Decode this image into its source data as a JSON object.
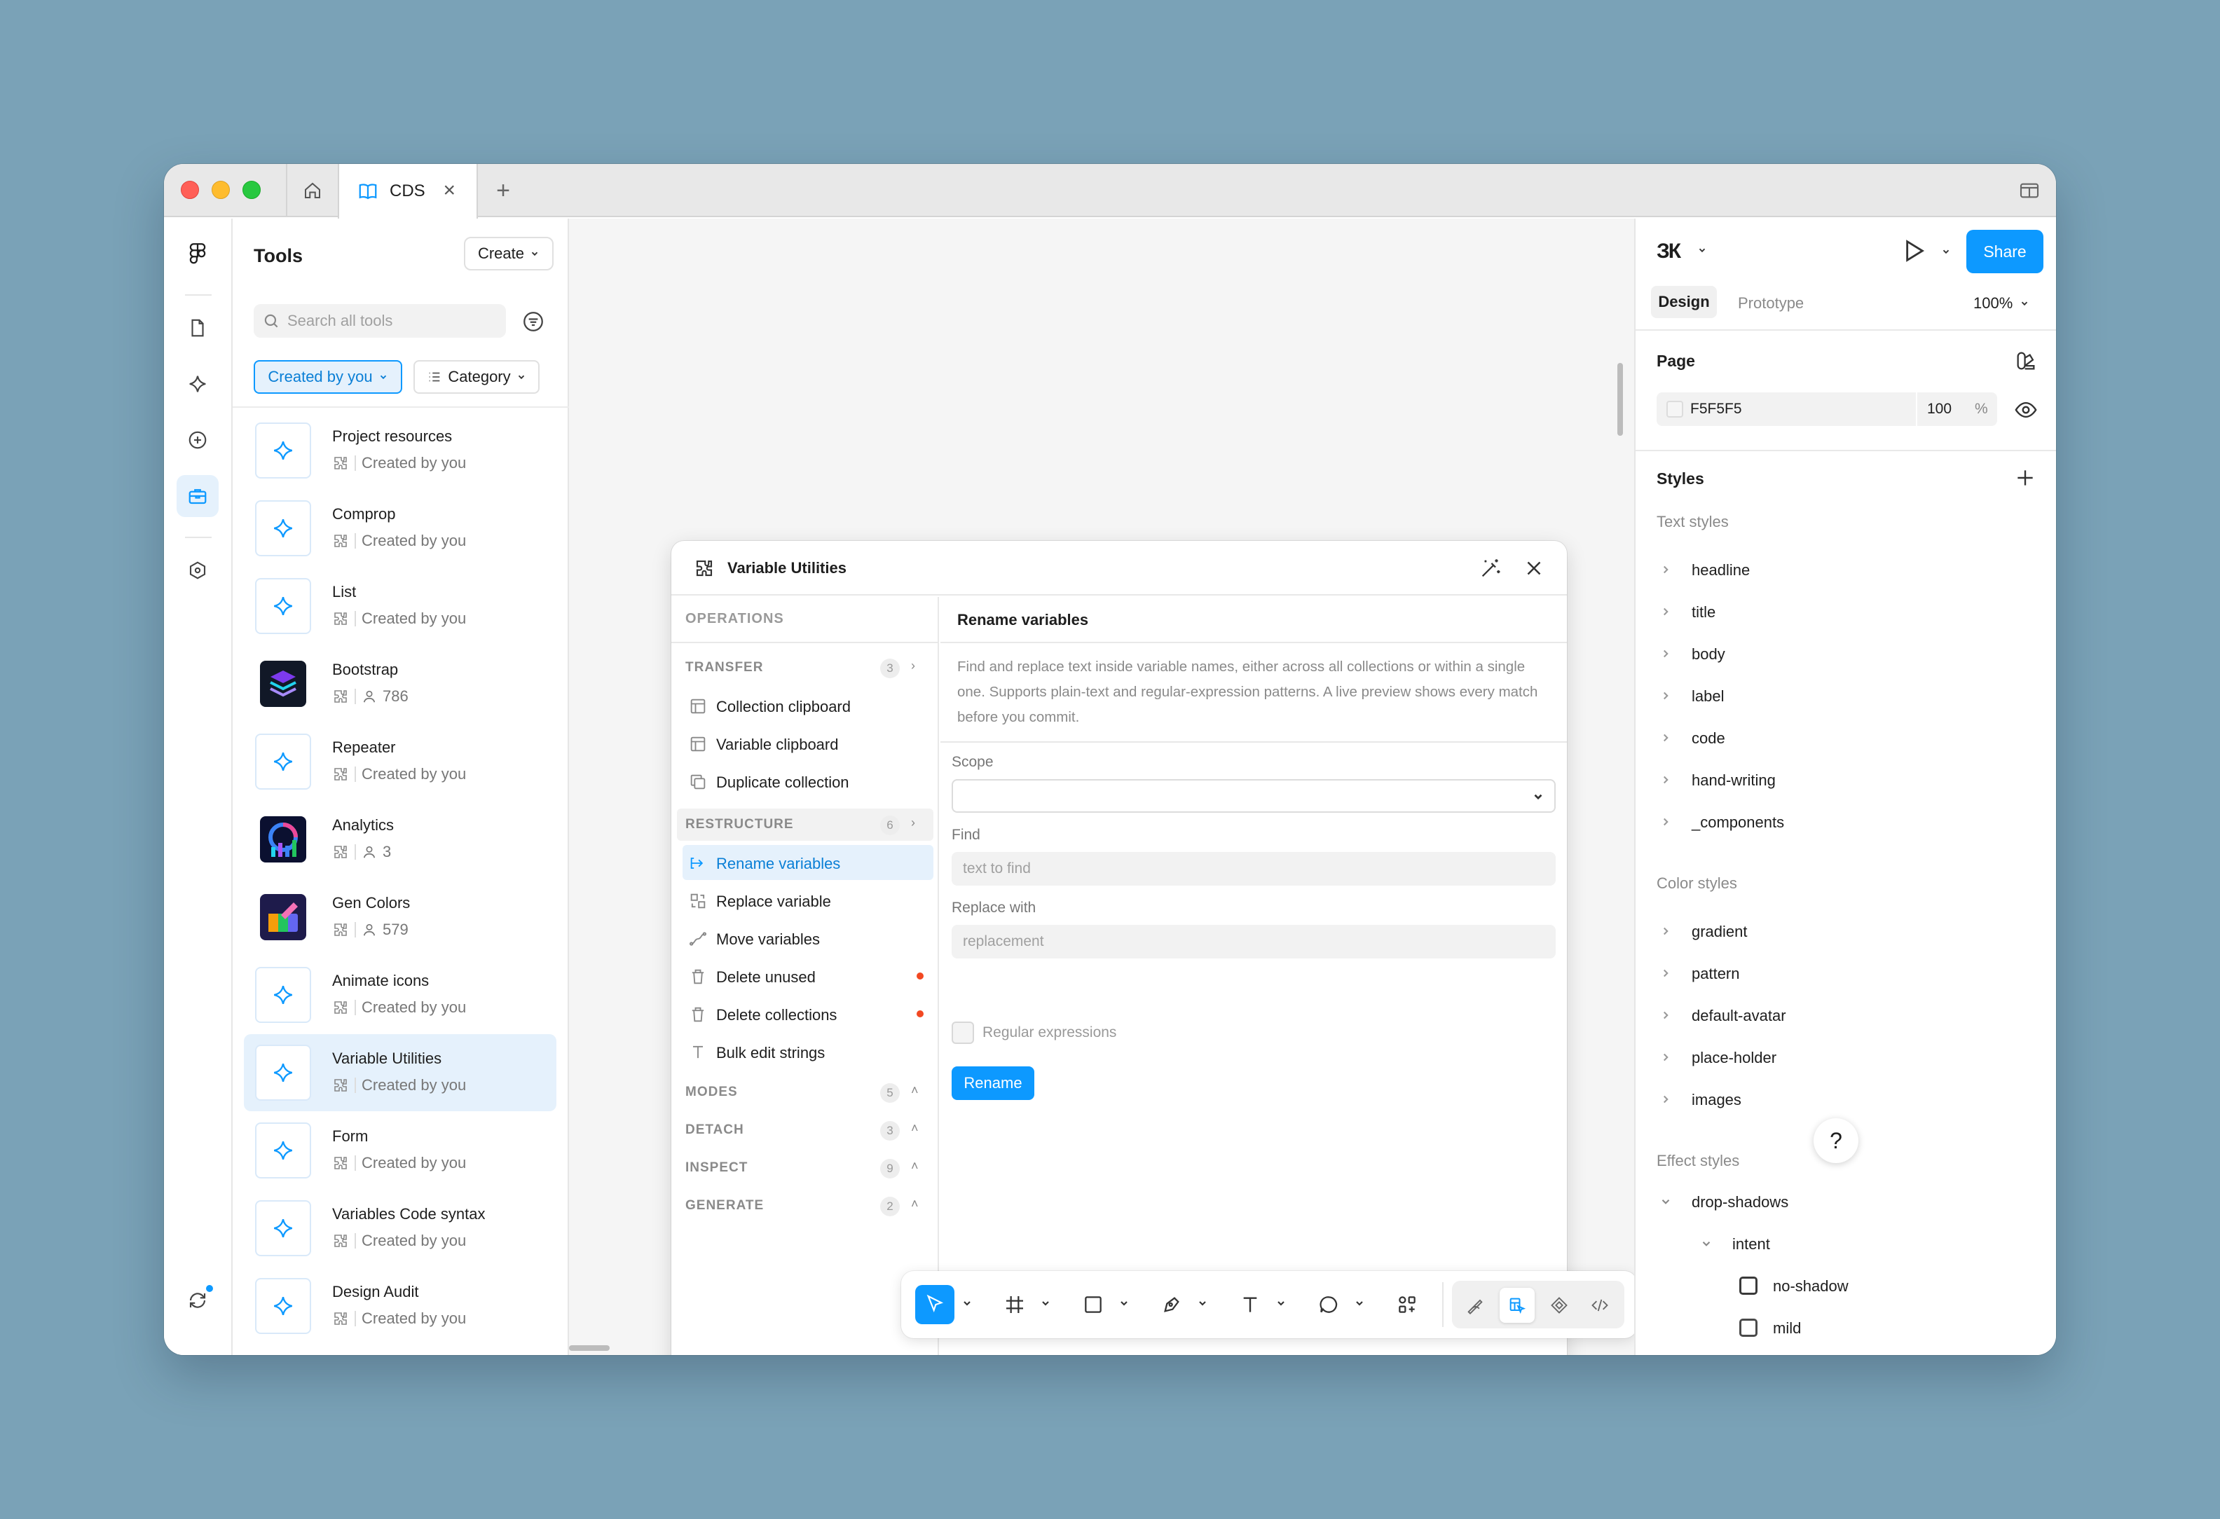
{
  "window": {
    "tab_title": "CDS"
  },
  "tools_panel": {
    "title": "Tools",
    "create_label": "Create",
    "search_placeholder": "Search all tools",
    "filter_created_by_you": "Created by you",
    "filter_category": "Category",
    "items": [
      {
        "name": "Project resources",
        "meta": "Created by you",
        "thumb": "sparkle-icon"
      },
      {
        "name": "Comprop",
        "meta": "Created by you",
        "thumb": "sparkle-icon"
      },
      {
        "name": "List",
        "meta": "Created by you",
        "thumb": "sparkle-icon"
      },
      {
        "name": "Bootstrap",
        "meta": "786",
        "thumb": "bootstrap-logo"
      },
      {
        "name": "Repeater",
        "meta": "Created by you",
        "thumb": "sparkle-icon"
      },
      {
        "name": "Analytics",
        "meta": "3",
        "thumb": "analytics-logo"
      },
      {
        "name": "Gen Colors",
        "meta": "579",
        "thumb": "gen-colors-logo"
      },
      {
        "name": "Animate icons",
        "meta": "Created by you",
        "thumb": "sparkle-icon"
      },
      {
        "name": "Variable Utilities",
        "meta": "Created by you",
        "thumb": "sparkle-icon",
        "selected": true
      },
      {
        "name": "Form",
        "meta": "Created by you",
        "thumb": "sparkle-icon"
      },
      {
        "name": "Variables Code syntax",
        "meta": "Created by you",
        "thumb": "sparkle-icon"
      },
      {
        "name": "Design Audit",
        "meta": "Created by you",
        "thumb": "sparkle-icon"
      }
    ]
  },
  "plugin": {
    "title": "Variable Utilities",
    "operations_header": "OPERATIONS",
    "sections": {
      "transfer": {
        "label": "TRANSFER",
        "count": "3"
      },
      "restructure": {
        "label": "RESTRUCTURE",
        "count": "6"
      },
      "modes": {
        "label": "MODES",
        "count": "5"
      },
      "detach": {
        "label": "DETACH",
        "count": "3"
      },
      "inspect": {
        "label": "INSPECT",
        "count": "9"
      },
      "generate": {
        "label": "GENERATE",
        "count": "2"
      }
    },
    "transfer_ops": [
      "Collection clipboard",
      "Variable clipboard",
      "Duplicate collection"
    ],
    "restructure_ops": [
      "Rename variables",
      "Replace variable",
      "Move variables",
      "Delete unused",
      "Delete collections",
      "Bulk edit strings"
    ],
    "active_op": "Rename variables",
    "detail": {
      "title": "Rename variables",
      "description": "Find and replace text inside variable names, either across all collections or within a single one. Supports plain-text and regular-expression patterns. A live preview shows every match before you commit.",
      "scope_label": "Scope",
      "scope_value": "",
      "find_label": "Find",
      "find_placeholder": "text to find",
      "replace_label": "Replace with",
      "replace_placeholder": "replacement",
      "regex_label": "Regular expressions",
      "regex_checked": false,
      "submit_label": "Rename"
    }
  },
  "right_panel": {
    "avatar_initials": "ЗК",
    "share_label": "Share",
    "tab_design": "Design",
    "tab_prototype": "Prototype",
    "zoom": "100%",
    "page_title": "Page",
    "page_color": "F5F5F5",
    "page_opacity": "100",
    "page_opacity_unit": "%",
    "styles_title": "Styles",
    "text_styles_label": "Text styles",
    "text_styles": [
      "headline",
      "title",
      "body",
      "label",
      "code",
      "hand-writing",
      "_components"
    ],
    "color_styles_label": "Color styles",
    "color_styles": [
      "gradient",
      "pattern",
      "default-avatar",
      "place-holder",
      "images"
    ],
    "effect_styles_label": "Effect styles",
    "effect_group": "drop-shadows",
    "effect_subgroup": "intent",
    "effect_items": [
      "no-shadow",
      "mild"
    ],
    "help_label": "?"
  },
  "colors": {
    "accent": "#0d99ff",
    "selected_bg": "#e5f1fc",
    "danger_dot": "#f24822",
    "desktop_bg": "#7aa2b7"
  }
}
